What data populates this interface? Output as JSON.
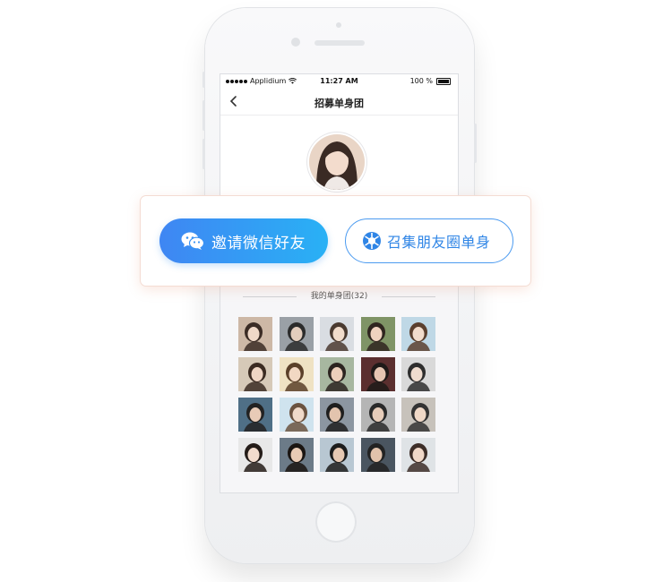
{
  "status_bar": {
    "carrier": "Applidium",
    "time": "11:27 AM",
    "battery": "100 %"
  },
  "navbar": {
    "title": "招募单身团"
  },
  "share_card": {
    "wechat_button_label": "邀请微信好友",
    "moments_button_label": "召集朋友圈单身"
  },
  "group_section": {
    "title": "我的单身团(32)"
  },
  "colors": {
    "primary_gradient_start": "#3f86f3",
    "primary_gradient_end": "#29b1f5",
    "outline_blue": "#4c9bf0"
  },
  "member_photos": [
    {
      "icon": "member-photo"
    },
    {
      "icon": "member-photo"
    },
    {
      "icon": "member-photo"
    },
    {
      "icon": "member-photo"
    },
    {
      "icon": "member-photo"
    },
    {
      "icon": "member-photo"
    },
    {
      "icon": "member-photo"
    },
    {
      "icon": "member-photo"
    },
    {
      "icon": "member-photo"
    },
    {
      "icon": "member-photo"
    },
    {
      "icon": "member-photo"
    },
    {
      "icon": "member-photo"
    },
    {
      "icon": "member-photo"
    },
    {
      "icon": "member-photo"
    },
    {
      "icon": "member-photo"
    },
    {
      "icon": "member-photo"
    },
    {
      "icon": "member-photo"
    },
    {
      "icon": "member-photo"
    },
    {
      "icon": "member-photo"
    },
    {
      "icon": "member-photo"
    }
  ]
}
